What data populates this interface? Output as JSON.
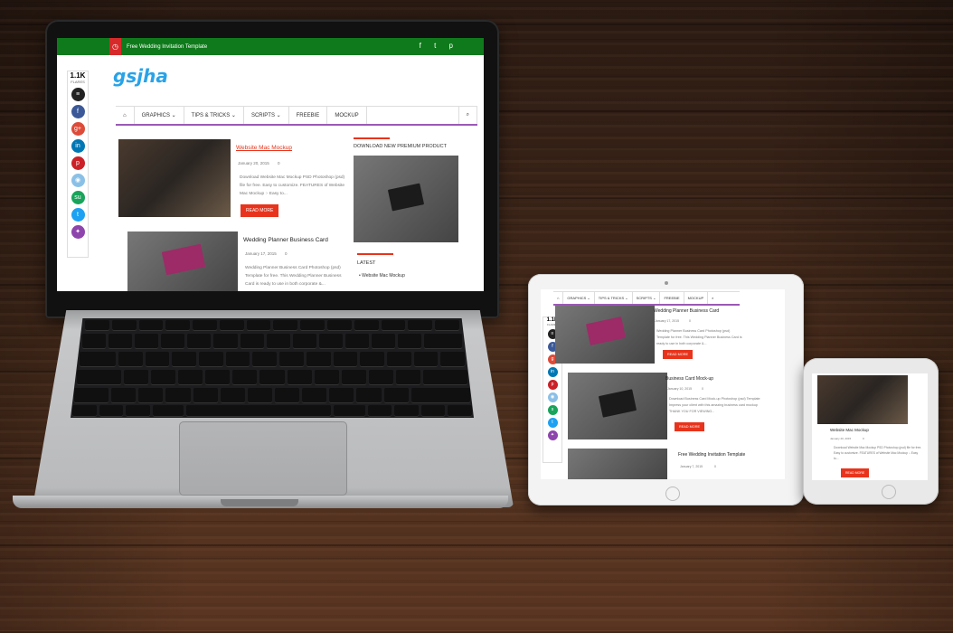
{
  "laptop": {
    "topbar_text": "Free Wedding Invitation Template",
    "social_icons": "f  t  p",
    "logo": "gsjha",
    "nav": [
      "GRAPHICS ⌄",
      "TIPS & TRICKS ⌄",
      "SCRIPTS ⌄",
      "FREEBIE",
      "MOCKUP"
    ],
    "share_count": "1.1K",
    "share_label": "FLARES",
    "share_buttons": [
      "buffer",
      "facebook",
      "google-plus",
      "linkedin",
      "pinterest",
      "reddit",
      "stumbleupon",
      "twitter",
      "flare"
    ],
    "posts": [
      {
        "title": "Website Mac Mockup",
        "date": "January 20, 2015",
        "comments": "0",
        "excerpt": "Download Website Mac Mockup PSD Photoshop (psd) file for free. Easy to customize. FEATURES of Website Mac Mockup :- Easy to...",
        "button": "READ MORE"
      },
      {
        "title": "Wedding Planner Business Card",
        "date": "January 17, 2015",
        "comments": "0",
        "excerpt": "Wedding Planner Business Card Photoshop (psd) Template for free. This Wedding Planner Business Card is ready to use in both corporate &...",
        "button": "READ MORE"
      }
    ],
    "sidebar_title": "DOWNLOAD NEW PREMIUM PRODUCT",
    "latest_title": "LATEST",
    "latest_items": [
      "Website Mac Mockup"
    ]
  },
  "tablet": {
    "nav": [
      "GRAPHICS ⌄",
      "TIPS & TRICKS ⌄",
      "SCRIPTS ⌄",
      "FREEBIE",
      "MOCKUP"
    ],
    "share_count": "1.1K",
    "share_label": "FLARES",
    "posts": [
      {
        "title": "Wedding Planner Business Card",
        "date": "January 17, 2015",
        "comments": "0",
        "excerpt": "Wedding Planner Business Card Photoshop (psd) Template for free. This Wedding Planner Business Card is ready to use in both corporate &...",
        "button": "READ MORE"
      },
      {
        "title": "Business Card Mock-up",
        "date": "January 10, 2015",
        "comments": "0",
        "excerpt": "Download Business Card Mock-up Photoshop (psd) Template Impress your client with this amazing business card mockup THANK YOU FOR VIEWING...",
        "button": "READ MORE"
      },
      {
        "title": "Free Wedding Invitation Template",
        "date": "January 7, 2015",
        "comments": "0"
      }
    ]
  },
  "phone": {
    "post": {
      "title": "Website Mac Mockup",
      "date": "January 20, 2015",
      "comments": "0",
      "excerpt": "Download Website Mac Mockup PSD Photoshop (psd) file for free. Easy to customize. FEATURES of Website Mac Mockup :- Easy to...",
      "button": "READ MORE"
    }
  }
}
